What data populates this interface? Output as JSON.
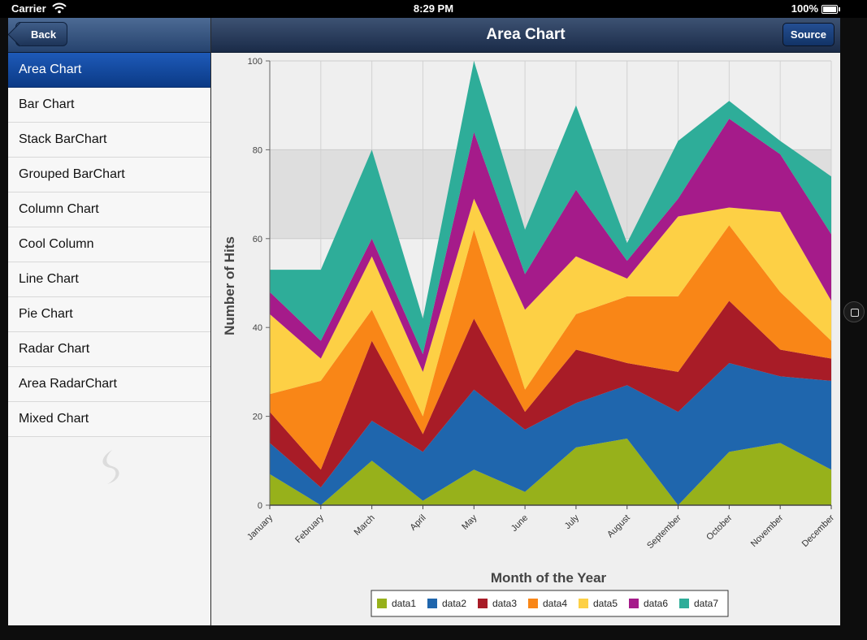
{
  "status": {
    "carrier": "Carrier",
    "time": "8:29 PM",
    "battery": "100%"
  },
  "nav": {
    "back_label": "Back",
    "title": "Area Chart",
    "source_label": "Source"
  },
  "menu": [
    {
      "label": "Area Chart",
      "active": true
    },
    {
      "label": "Bar Chart"
    },
    {
      "label": "Stack BarChart"
    },
    {
      "label": "Grouped BarChart"
    },
    {
      "label": "Column Chart"
    },
    {
      "label": "Cool Column"
    },
    {
      "label": "Line Chart"
    },
    {
      "label": "Pie Chart"
    },
    {
      "label": "Radar Chart"
    },
    {
      "label": "Area RadarChart"
    },
    {
      "label": "Mixed Chart"
    }
  ],
  "chart_data": {
    "type": "area",
    "stacked": true,
    "xlabel": "Month of the Year",
    "ylabel": "Number of Hits",
    "ylim": [
      0,
      100
    ],
    "yticks": [
      0,
      20,
      40,
      60,
      80,
      100
    ],
    "categories": [
      "January",
      "February",
      "March",
      "April",
      "May",
      "June",
      "July",
      "August",
      "September",
      "October",
      "November",
      "December"
    ],
    "grid": "alternating horizontal bands",
    "legend_position": "bottom",
    "series": [
      {
        "name": "data1",
        "color": "#97b11b",
        "values": [
          7,
          0,
          10,
          1,
          8,
          3,
          13,
          15,
          0,
          12,
          14,
          8
        ]
      },
      {
        "name": "data2",
        "color": "#1f66ad",
        "values": [
          7,
          4,
          9,
          11,
          18,
          14,
          10,
          12,
          21,
          20,
          15,
          20
        ]
      },
      {
        "name": "data3",
        "color": "#a81c27",
        "values": [
          7,
          4,
          18,
          4,
          16,
          4,
          12,
          5,
          9,
          14,
          6,
          5
        ]
      },
      {
        "name": "data4",
        "color": "#f98617",
        "values": [
          4,
          20,
          7,
          4,
          20,
          5,
          8,
          15,
          17,
          17,
          13,
          4
        ]
      },
      {
        "name": "data5",
        "color": "#fdd045",
        "values": [
          18,
          5,
          12,
          10,
          7,
          18,
          13,
          4,
          18,
          4,
          18,
          9
        ]
      },
      {
        "name": "data6",
        "color": "#a51b8a",
        "values": [
          5,
          4,
          4,
          4,
          15,
          8,
          15,
          4,
          4,
          20,
          13,
          15
        ]
      },
      {
        "name": "data7",
        "color": "#2ead99",
        "values": [
          5,
          16,
          20,
          8,
          16,
          10,
          19,
          4,
          13,
          4,
          3,
          13
        ]
      }
    ]
  }
}
